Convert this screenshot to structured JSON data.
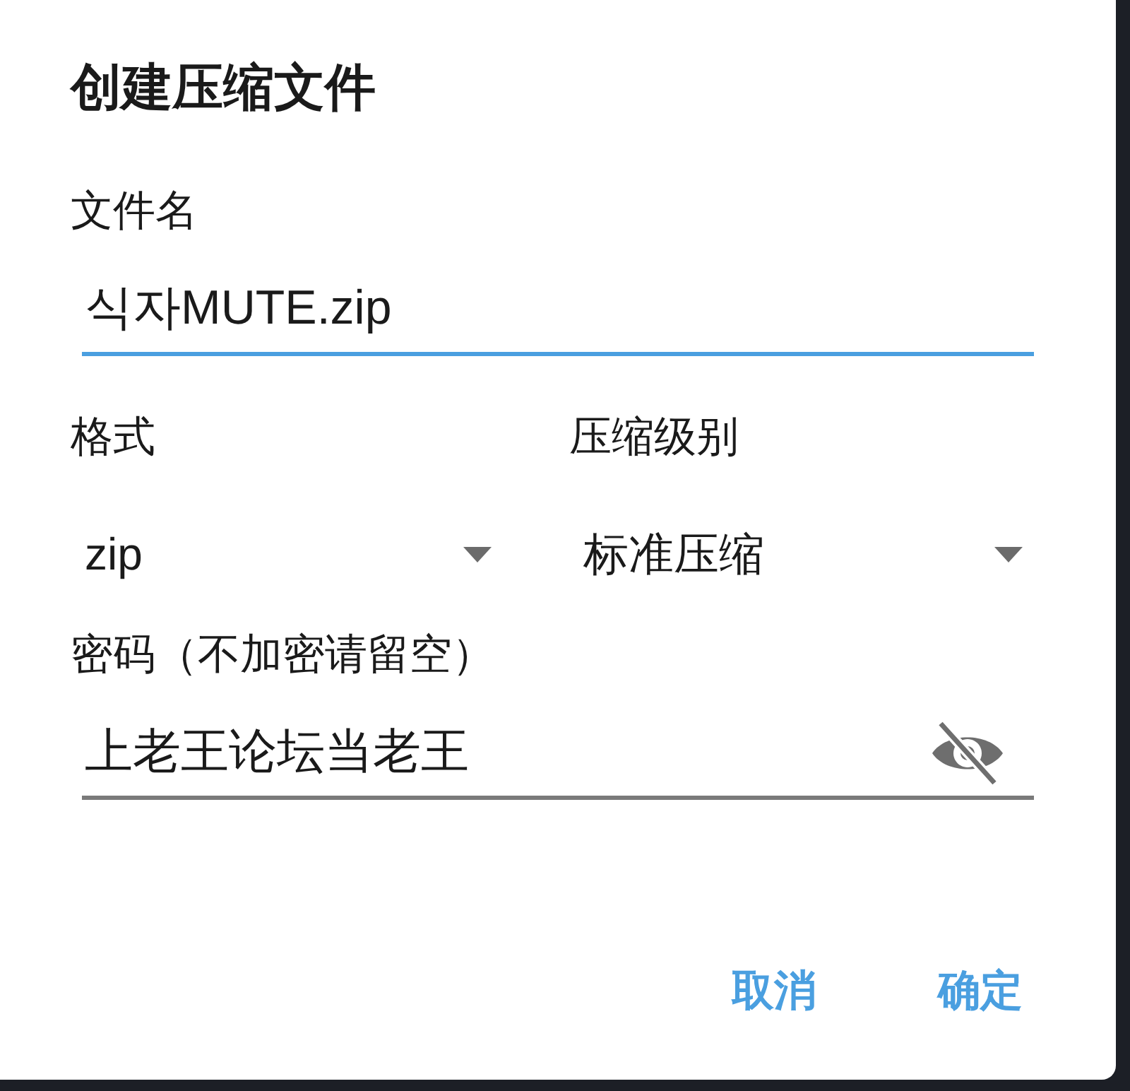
{
  "dialog": {
    "title": "创建压缩文件"
  },
  "filename": {
    "label": "文件名",
    "value": "식자MUTE.zip",
    "focused": true
  },
  "format": {
    "label": "格式",
    "value": "zip"
  },
  "level_select": {
    "label": "压缩级别",
    "value": "标准压缩"
  },
  "password": {
    "label": "密码（不加密请留空）",
    "value": "上老王论坛当老王",
    "focused": false
  },
  "buttons": [
    {
      "label": "取消"
    },
    {
      "label": "确定"
    }
  ]
}
